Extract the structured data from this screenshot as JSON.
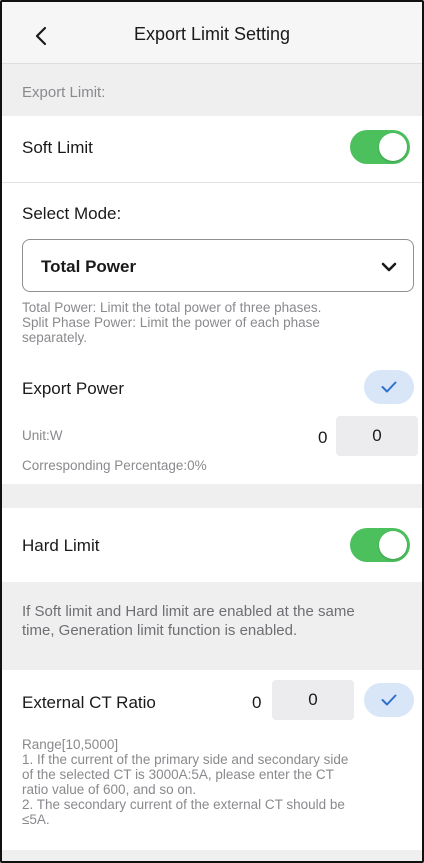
{
  "header": {
    "title": "Export Limit Setting",
    "back_icon": "chevron-left-icon"
  },
  "export_limit": {
    "section_label": "Export Limit:",
    "soft_limit": {
      "label": "Soft Limit",
      "enabled": true
    },
    "select_mode": {
      "label": "Select Mode:",
      "value": "Total Power",
      "icon": "chevron-down-icon",
      "description_line1": "Total Power: Limit the total power of three phases.",
      "description_line2": "Split Phase Power: Limit the power of each phase",
      "description_line3": "separately."
    },
    "export_power": {
      "label": "Export Power",
      "unit": "Unit:W",
      "current_value": "0",
      "input_value": "0",
      "percentage": "Corresponding Percentage:0%",
      "confirm_icon": "checkmark-icon"
    }
  },
  "hard_limit": {
    "label": "Hard Limit",
    "enabled": true,
    "info_line1": "If Soft limit and Hard limit are enabled at the same",
    "info_line2": "time, Generation limit function  is enabled."
  },
  "external_ct": {
    "label": "External CT Ratio",
    "current_value": "0",
    "input_value": "0",
    "confirm_icon": "checkmark-icon",
    "range": "Range[10,5000]",
    "note_1a": "1. If the current of the primary side and secondary side",
    "note_1b": "of the selected CT is 3000A:5A, please enter the CT",
    "note_1c": "ratio value of 600, and so on.",
    "note_2a": "2. The secondary current of the external CT should be",
    "note_2b": "≤5A."
  },
  "colors": {
    "toggle_on": "#4cc05d",
    "confirm_bg": "#d8e6f7",
    "confirm_check": "#2f6fd0"
  }
}
